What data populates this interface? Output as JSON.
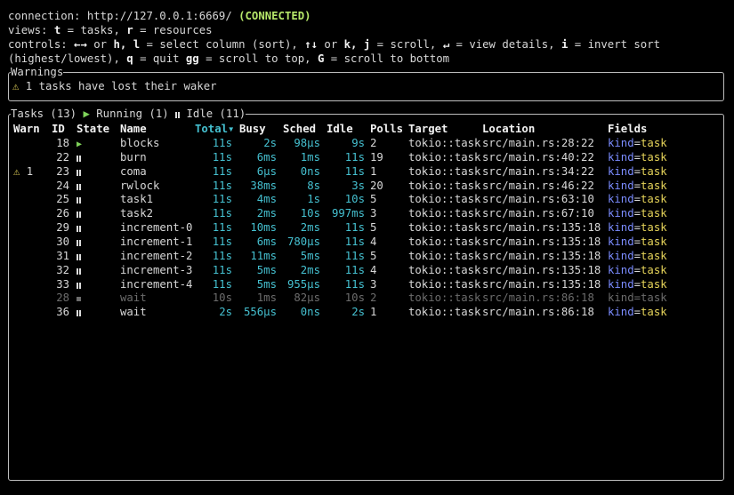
{
  "header": {
    "connection_label": "connection: ",
    "connection_url": "http://127.0.0.1:6669/",
    "connection_status": "(CONNECTED)",
    "views_line": [
      {
        "t": "views: ",
        "b": false
      },
      {
        "t": "t",
        "b": true
      },
      {
        "t": " = tasks, ",
        "b": false
      },
      {
        "t": "r",
        "b": true
      },
      {
        "t": " = resources",
        "b": false
      }
    ],
    "controls_line1": [
      {
        "t": "controls: ",
        "b": false
      },
      {
        "t": "←→",
        "b": true
      },
      {
        "t": " or ",
        "b": false
      },
      {
        "t": "h, l",
        "b": true
      },
      {
        "t": " = select column (sort), ",
        "b": false
      },
      {
        "t": "↑↓",
        "b": true
      },
      {
        "t": " or ",
        "b": false
      },
      {
        "t": "k, j",
        "b": true
      },
      {
        "t": " = scroll, ",
        "b": false
      },
      {
        "t": "↵",
        "b": true
      },
      {
        "t": " = view details, ",
        "b": false
      },
      {
        "t": "i",
        "b": true
      },
      {
        "t": " = invert sort",
        "b": false
      }
    ],
    "controls_line2": [
      {
        "t": "(highest/lowest), ",
        "b": false
      },
      {
        "t": "q",
        "b": true
      },
      {
        "t": " = quit ",
        "b": false
      },
      {
        "t": "gg",
        "b": true
      },
      {
        "t": " = scroll to top, ",
        "b": false
      },
      {
        "t": "G",
        "b": true
      },
      {
        "t": " = scroll to bottom",
        "b": false
      }
    ]
  },
  "warnings": {
    "title": "Warnings",
    "items": [
      "⚠ 1 tasks have lost their waker"
    ]
  },
  "tasks": {
    "title": "Tasks (13)",
    "running_label": "Running (1)",
    "idle_label": "Idle (11)",
    "columns": {
      "warn": "Warn",
      "id": "ID",
      "state": "State",
      "name": "Name",
      "total": "Total",
      "total_sort_arrow": "▾",
      "busy": "Busy",
      "sched": "Sched",
      "idle": "Idle",
      "polls": "Polls",
      "target": "Target",
      "location": "Location",
      "fields": "Fields"
    },
    "rows": [
      {
        "warn": "",
        "id": "18",
        "state": "running",
        "name": "blocks",
        "total": "11s",
        "busy": "2s",
        "sched": "98µs",
        "idle": "9s",
        "polls": "2",
        "target": "tokio::task",
        "location": "src/main.rs:28:22",
        "field_key": "kind",
        "field_val": "task",
        "dim": false
      },
      {
        "warn": "",
        "id": "22",
        "state": "idle",
        "name": "burn",
        "total": "11s",
        "busy": "6ms",
        "sched": "1ms",
        "idle": "11s",
        "polls": "19",
        "target": "tokio::task",
        "location": "src/main.rs:40:22",
        "field_key": "kind",
        "field_val": "task",
        "dim": false
      },
      {
        "warn": "⚠ 1",
        "id": "23",
        "state": "idle",
        "name": "coma",
        "total": "11s",
        "busy": "6µs",
        "sched": "0ns",
        "idle": "11s",
        "polls": "1",
        "target": "tokio::task",
        "location": "src/main.rs:34:22",
        "field_key": "kind",
        "field_val": "task",
        "dim": false
      },
      {
        "warn": "",
        "id": "24",
        "state": "idle",
        "name": "rwlock",
        "total": "11s",
        "busy": "38ms",
        "sched": "8s",
        "idle": "3s",
        "polls": "20",
        "target": "tokio::task",
        "location": "src/main.rs:46:22",
        "field_key": "kind",
        "field_val": "task",
        "dim": false
      },
      {
        "warn": "",
        "id": "25",
        "state": "idle",
        "name": "task1",
        "total": "11s",
        "busy": "4ms",
        "sched": "1s",
        "idle": "10s",
        "polls": "5",
        "target": "tokio::task",
        "location": "src/main.rs:63:10",
        "field_key": "kind",
        "field_val": "task",
        "dim": false
      },
      {
        "warn": "",
        "id": "26",
        "state": "idle",
        "name": "task2",
        "total": "11s",
        "busy": "2ms",
        "sched": "10s",
        "idle": "997ms",
        "polls": "3",
        "target": "tokio::task",
        "location": "src/main.rs:67:10",
        "field_key": "kind",
        "field_val": "task",
        "dim": false
      },
      {
        "warn": "",
        "id": "29",
        "state": "idle",
        "name": "increment-0",
        "total": "11s",
        "busy": "10ms",
        "sched": "2ms",
        "idle": "11s",
        "polls": "5",
        "target": "tokio::task",
        "location": "src/main.rs:135:18",
        "field_key": "kind",
        "field_val": "task",
        "dim": false
      },
      {
        "warn": "",
        "id": "30",
        "state": "idle",
        "name": "increment-1",
        "total": "11s",
        "busy": "6ms",
        "sched": "780µs",
        "idle": "11s",
        "polls": "4",
        "target": "tokio::task",
        "location": "src/main.rs:135:18",
        "field_key": "kind",
        "field_val": "task",
        "dim": false
      },
      {
        "warn": "",
        "id": "31",
        "state": "idle",
        "name": "increment-2",
        "total": "11s",
        "busy": "11ms",
        "sched": "5ms",
        "idle": "11s",
        "polls": "5",
        "target": "tokio::task",
        "location": "src/main.rs:135:18",
        "field_key": "kind",
        "field_val": "task",
        "dim": false
      },
      {
        "warn": "",
        "id": "32",
        "state": "idle",
        "name": "increment-3",
        "total": "11s",
        "busy": "5ms",
        "sched": "2ms",
        "idle": "11s",
        "polls": "4",
        "target": "tokio::task",
        "location": "src/main.rs:135:18",
        "field_key": "kind",
        "field_val": "task",
        "dim": false
      },
      {
        "warn": "",
        "id": "33",
        "state": "idle",
        "name": "increment-4",
        "total": "11s",
        "busy": "5ms",
        "sched": "955µs",
        "idle": "11s",
        "polls": "3",
        "target": "tokio::task",
        "location": "src/main.rs:135:18",
        "field_key": "kind",
        "field_val": "task",
        "dim": false
      },
      {
        "warn": "",
        "id": "28",
        "state": "done",
        "name": "wait",
        "total": "10s",
        "busy": "1ms",
        "sched": "82µs",
        "idle": "10s",
        "polls": "2",
        "target": "tokio::task",
        "location": "src/main.rs:86:18",
        "field_key": "kind",
        "field_val": "task",
        "dim": true
      },
      {
        "warn": "",
        "id": "36",
        "state": "idle",
        "name": "wait",
        "total": "2s",
        "busy": "556µs",
        "sched": "0ns",
        "idle": "2s",
        "polls": "1",
        "target": "tokio::task",
        "location": "src/main.rs:86:18",
        "field_key": "kind",
        "field_val": "task",
        "dim": false
      }
    ]
  },
  "colors": {
    "connected": "#b7e86a",
    "running": "#7fd35a",
    "warning": "#e6d45a",
    "time_values": "#45c0d0",
    "field_key": "#7b8cff",
    "field_value": "#e6d45a",
    "dim": "#6c6c6c"
  }
}
